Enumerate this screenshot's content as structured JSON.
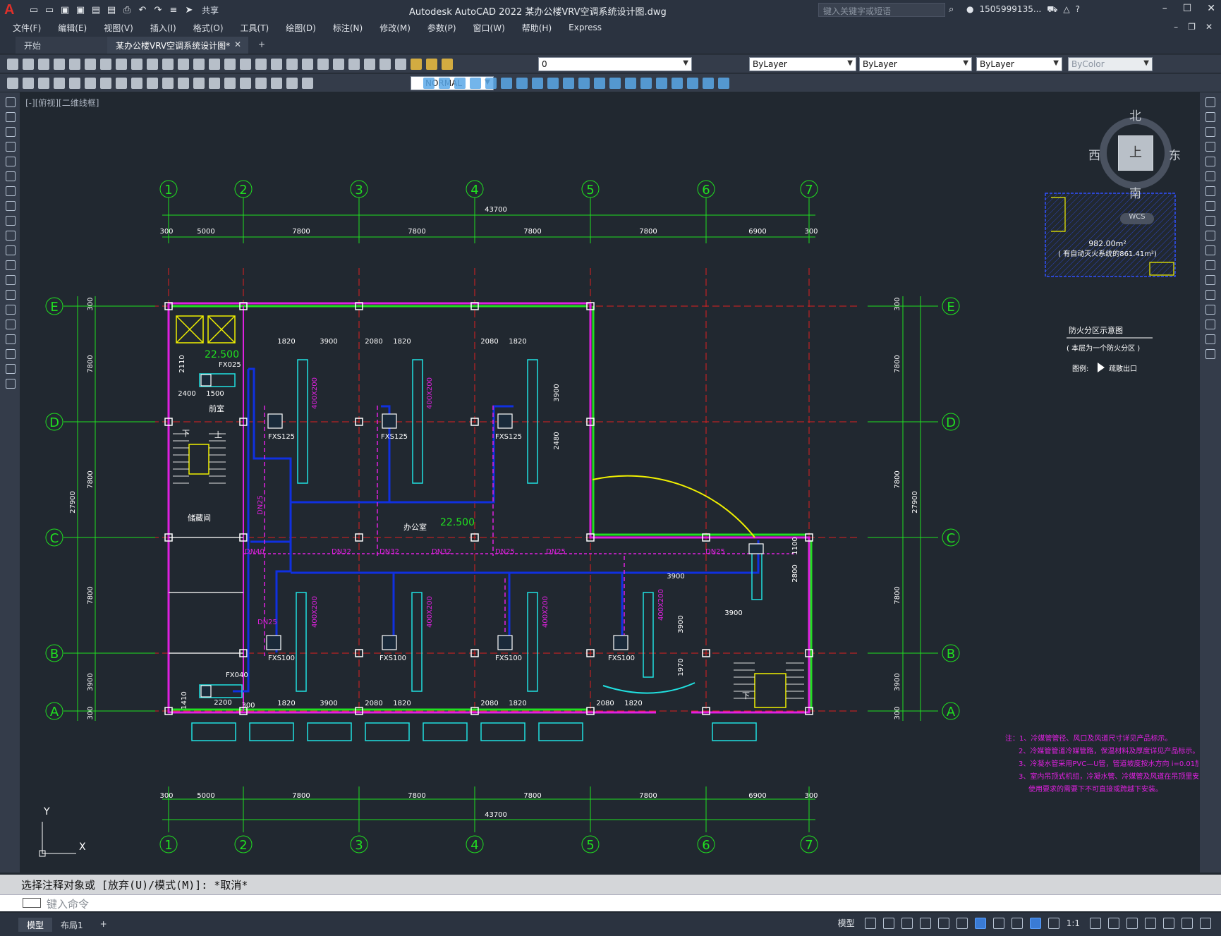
{
  "app": {
    "title": "Autodesk AutoCAD 2022    某办公楼VRV空调系统设计图.dwg",
    "search_placeholder": "键入关键字或短语",
    "user": "1505999135...",
    "share_label": "共享"
  },
  "menu": [
    "文件(F)",
    "编辑(E)",
    "视图(V)",
    "插入(I)",
    "格式(O)",
    "工具(T)",
    "绘图(D)",
    "标注(N)",
    "修改(M)",
    "参数(P)",
    "窗口(W)",
    "帮助(H)",
    "Express"
  ],
  "tabs": {
    "start": "开始",
    "active": "某办公楼VRV空调系统设计图*",
    "add": "+"
  },
  "toolbar": {
    "layer_value": "0",
    "color": "ByLayer",
    "linetype": "ByLayer",
    "lineweight": "ByLayer",
    "plotstyle": "ByColor",
    "textstyle": "NORMAL"
  },
  "viewport": {
    "label": "[-][俯视][二维线框]"
  },
  "viewcube": {
    "north": "北",
    "south": "南",
    "east": "东",
    "west": "西",
    "top": "上",
    "wcs": "WCS"
  },
  "grid": {
    "columns": [
      "1",
      "2",
      "3",
      "4",
      "5",
      "6",
      "7"
    ],
    "rows": [
      "E",
      "D",
      "C",
      "B",
      "A"
    ],
    "total_width": "43700",
    "total_height": "27900",
    "col_spacing": [
      "300",
      "5000",
      "7800",
      "7800",
      "7800",
      "7800",
      "6900",
      "300"
    ],
    "row_spacing": [
      "300",
      "7800",
      "7800",
      "7800",
      "3900",
      "300"
    ]
  },
  "labels": {
    "elev1": "22.500",
    "elev2": "22.500",
    "office": "办公室",
    "front_room": "前室",
    "storage": "储藏间",
    "up": "上",
    "down": "下",
    "elevator": "电梯",
    "units": [
      "FX025",
      "FX040",
      "FXS125",
      "FXS125",
      "FXS125",
      "FXS100",
      "FXS100",
      "FXS100",
      "FXS100"
    ],
    "pipes": [
      "DN25",
      "DN32",
      "DN32",
      "DN32",
      "DN25",
      "DN25",
      "DN25",
      "DN40",
      "DN25"
    ],
    "duct": "400X200",
    "dims_top": [
      "1820",
      "3900",
      "2080",
      "1820",
      "2080",
      "1820"
    ],
    "dims_bottom": [
      "1820",
      "3900",
      "2080",
      "1820",
      "2080",
      "1820",
      "2080",
      "1820"
    ],
    "dims_misc": [
      "2110",
      "2400",
      "1500",
      "3900",
      "2480",
      "3900",
      "3900",
      "2800",
      "1100",
      "3900",
      "1970",
      "2200",
      "1410",
      "300"
    ]
  },
  "fire_zone": {
    "area": "982.00m²",
    "area_note": "( 有自动灭火系统的861.41m²)",
    "title": "防火分区示意图",
    "subtitle": "( 本层为一个防火分区 )",
    "legend_label": "图例:",
    "legend_item": "疏散出口"
  },
  "notes": [
    "注：1、冷媒管管径、风口及风道尺寸详见产品标示。",
    "2、冷媒管管道冷媒管路，保温材料及厚度详见产品标示。",
    "3、冷凝水管采用PVC—U管，管道坡度按水方向 i=0.01放坡。",
    "3、室内吊顶式机组，冷凝水管、冷媒管及风道在吊顶里安装，",
    "使用要求的需要下不可直接或跨越下安装。"
  ],
  "command": {
    "history": "选择注释对象或 [放弃(U)/模式(M)]: *取消*",
    "placeholder": "键入命令"
  },
  "status": {
    "tabs": [
      "模型",
      "布局1"
    ],
    "add": "+",
    "model_label": "模型",
    "scale": "1:1"
  },
  "colors": {
    "grid_green": "#20e020",
    "axis_red": "#e02020",
    "wall_magenta": "#e020e0",
    "duct_cyan": "#20e0e0",
    "pipe_blue": "#1030e0",
    "stair_yellow": "#f0f000"
  }
}
